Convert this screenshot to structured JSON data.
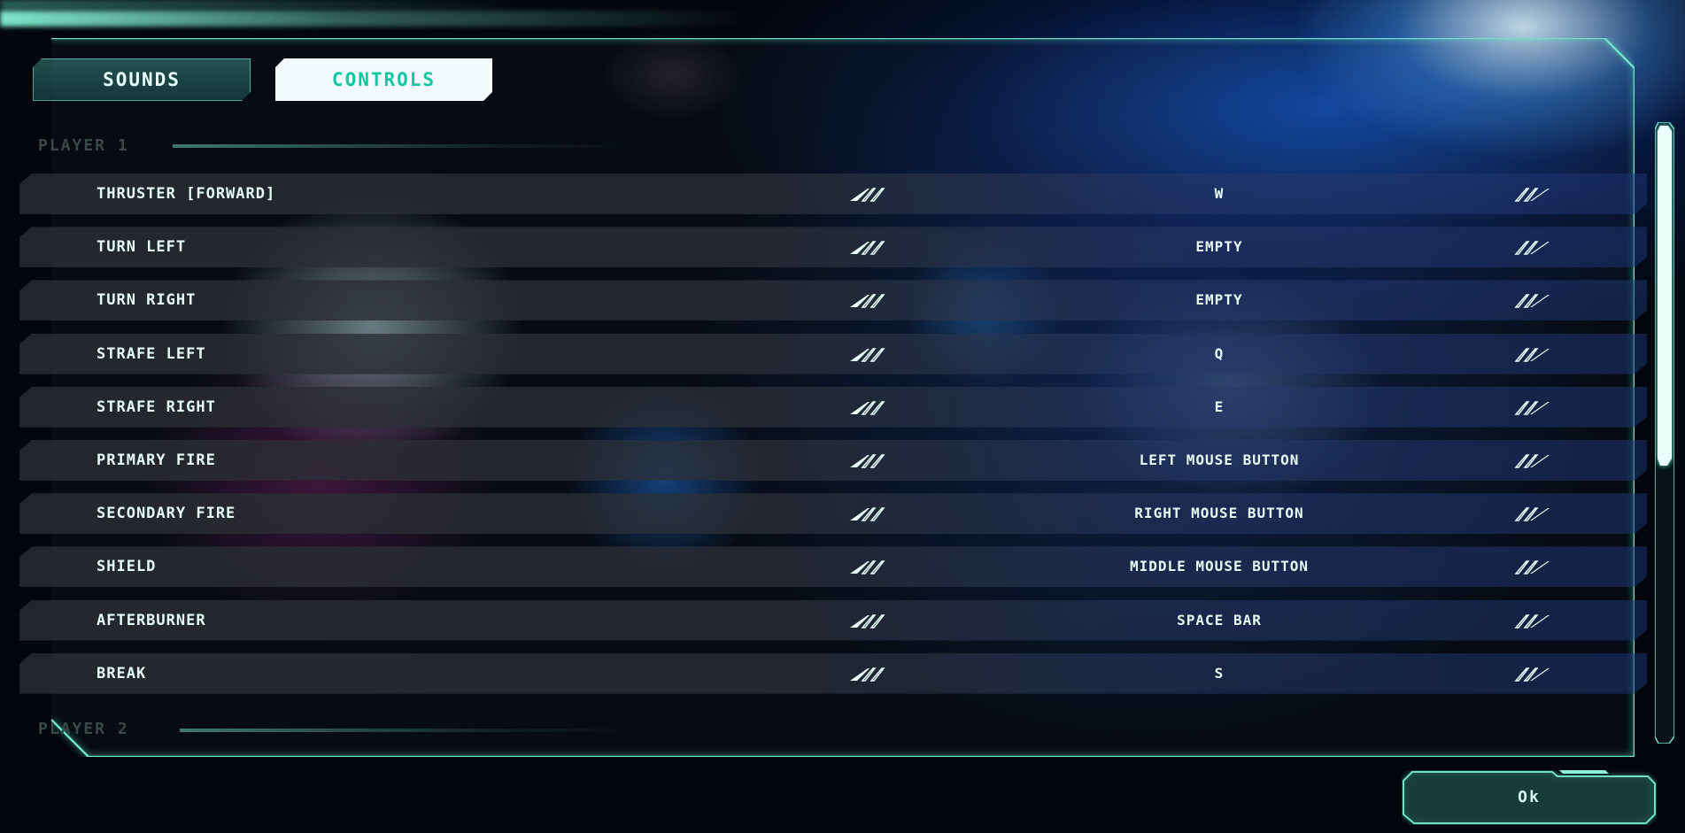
{
  "tabs": [
    {
      "label": "SOUNDS",
      "active": false
    },
    {
      "label": "CONTROLS",
      "active": true
    }
  ],
  "sections": {
    "player1": "PLAYER 1",
    "player2": "PLAYER 2"
  },
  "controls": [
    {
      "action": "THRUSTER [FORWARD]",
      "key": "W"
    },
    {
      "action": "TURN LEFT",
      "key": "EMPTY"
    },
    {
      "action": "TURN RIGHT",
      "key": "EMPTY"
    },
    {
      "action": "STRAFE LEFT",
      "key": "Q"
    },
    {
      "action": "STRAFE RIGHT",
      "key": "E"
    },
    {
      "action": "PRIMARY FIRE",
      "key": "LEFT MOUSE BUTTON"
    },
    {
      "action": "SECONDARY FIRE",
      "key": "RIGHT MOUSE BUTTON"
    },
    {
      "action": "SHIELD",
      "key": "MIDDLE MOUSE BUTTON"
    },
    {
      "action": "AFTERBURNER",
      "key": "SPACE BAR"
    },
    {
      "action": "BREAK",
      "key": "S"
    }
  ],
  "buttons": {
    "ok": "Ok"
  },
  "colors": {
    "accent": "#5fe3c6",
    "text": "#e6fbf5",
    "tab_active_bg": "#f4fbfc",
    "tab_active_text": "#12c7a3"
  },
  "icons": {
    "prev": "arrow-left-icon",
    "next": "arrow-right-icon"
  }
}
